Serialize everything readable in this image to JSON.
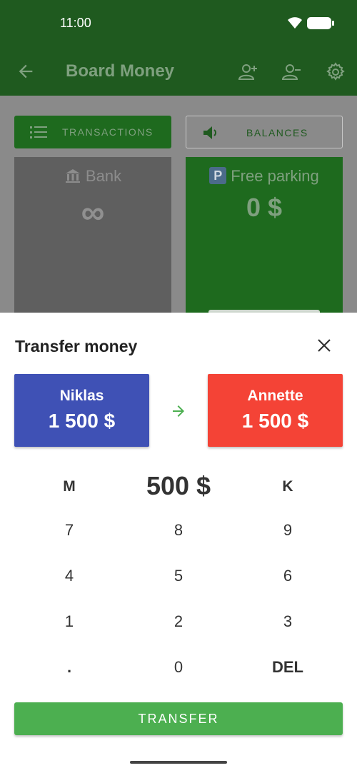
{
  "status_bar": {
    "time": "11:00"
  },
  "app_bar": {
    "title": "Board Money",
    "back_icon": "arrow-left-icon",
    "actions": [
      "add-player-icon",
      "remove-player-icon",
      "settings-icon"
    ]
  },
  "background": {
    "transactions_button": "TRANSACTIONS",
    "balances_button": "BALANCES",
    "bank": {
      "title": "Bank",
      "value": "∞"
    },
    "free_parking": {
      "badge": "P",
      "title": "Free parking",
      "value": "0 $"
    }
  },
  "sheet": {
    "title": "Transfer money",
    "from": {
      "name": "Niklas",
      "balance": "1 500 $",
      "color": "#3f51b5"
    },
    "to": {
      "name": "Annette",
      "balance": "1 500 $",
      "color": "#f44336"
    },
    "amount": "500 $",
    "key_m": "M",
    "key_k": "K",
    "keys": [
      "7",
      "8",
      "9",
      "4",
      "5",
      "6",
      "1",
      "2",
      "3",
      ".",
      "0",
      "DEL"
    ],
    "transfer_button": "TRANSFER"
  },
  "colors": {
    "app_bar": "#1f5a1f",
    "transfer_button": "#4caf50",
    "arrow": "#4caf50"
  }
}
